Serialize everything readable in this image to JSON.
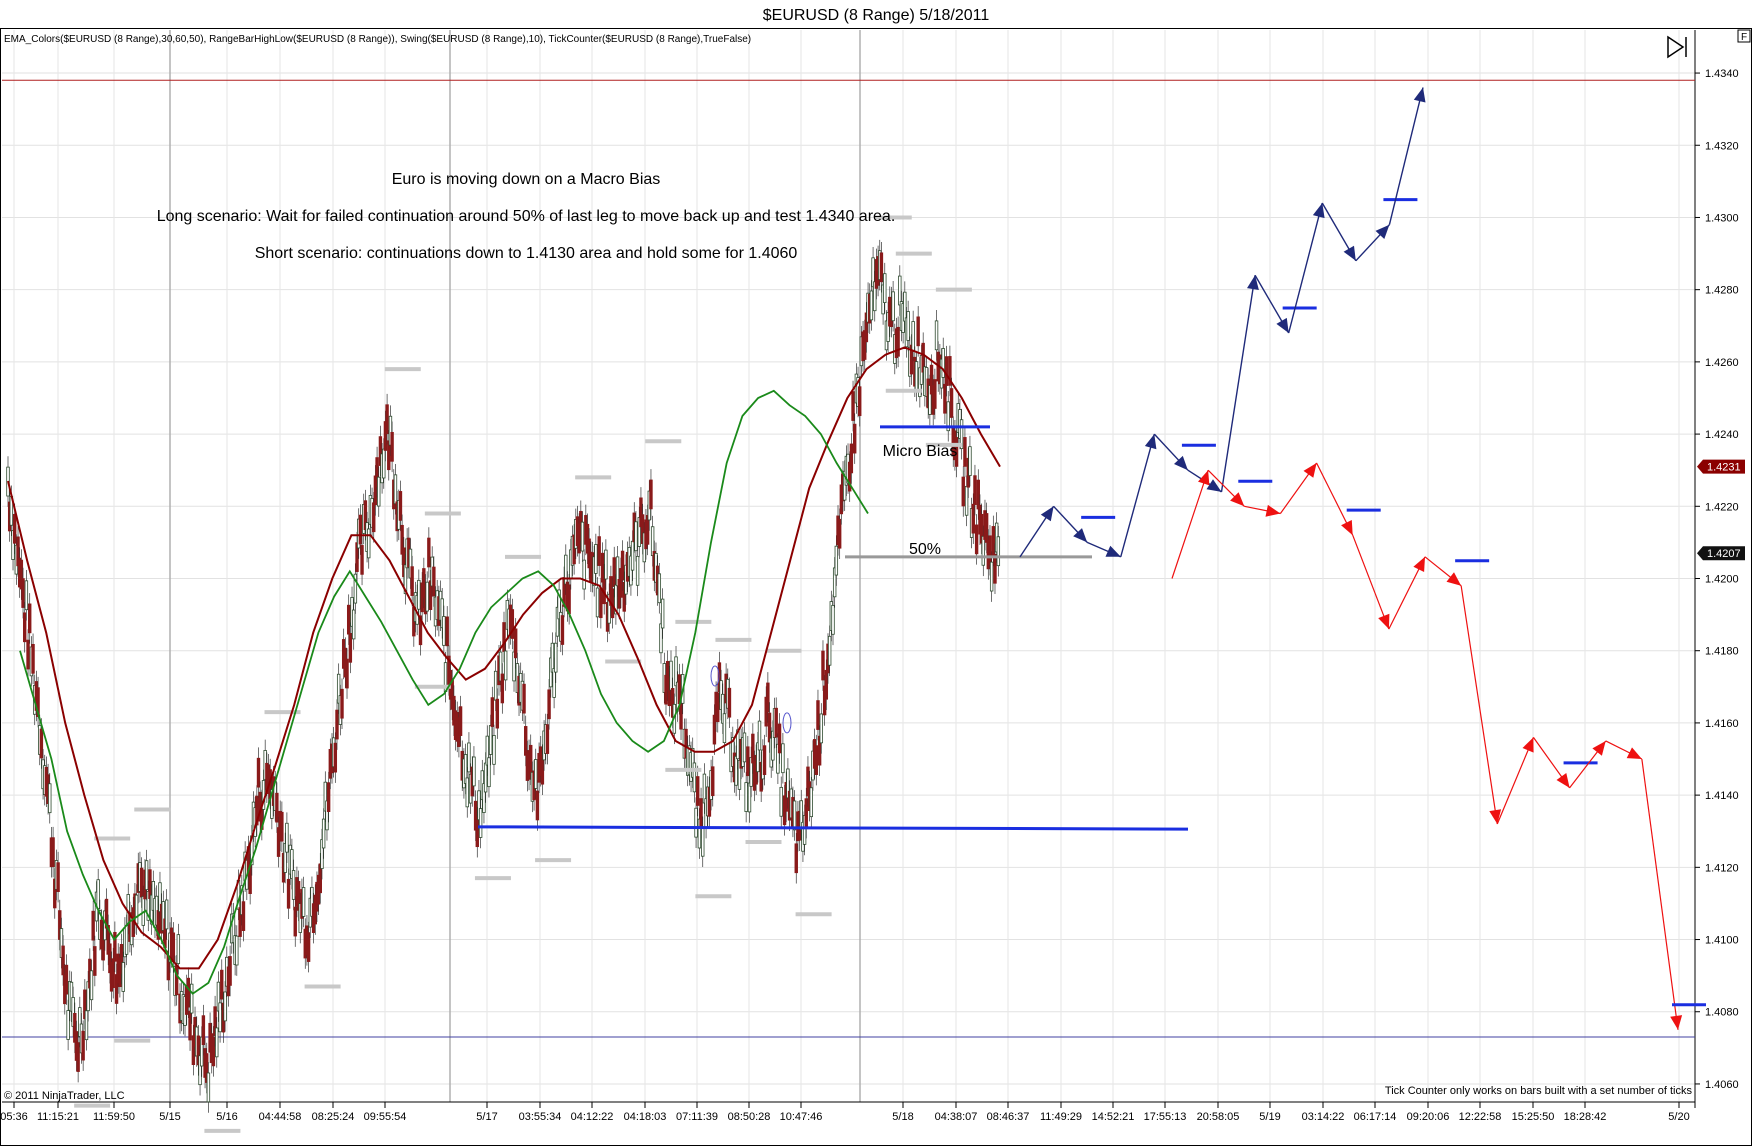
{
  "window": {
    "title": "$EURUSD (8 Range)  5/18/2011",
    "indicators": "EMA_Colors($EURUSD (8 Range),30,60,50), RangeBarHighLow($EURUSD (8 Range)), Swing($EURUSD (8 Range),10), TickCounter($EURUSD (8 Range),TrueFalse)",
    "copyright": "© 2011 NinjaTrader, LLC",
    "tick_note": "Tick Counter only works on bars built with a set number of ticks",
    "corner_label": "F"
  },
  "annotations": {
    "macro": "Euro is moving down on a Macro Bias",
    "long": "Long scenario: Wait for failed continuation around 50% of last leg to move back up and test 1.4340 area.",
    "short": "Short scenario: continuations down to 1.4130 area and hold some for 1.4060",
    "micro_bias": "Micro Bias",
    "fifty": "50%"
  },
  "colors": {
    "up_candle": "#2e4a2e",
    "down_candle": "#8a1a1a",
    "ema_fast_green": "#1a8a1a",
    "ema_slow_red": "#8b0000",
    "bull_path": "#1f2a7a",
    "bear_path": "#ee1111",
    "support_line": "#1a2ee0",
    "resistance_red_line": "#b02020",
    "low_line_navy": "#4040a0",
    "swing_marker": "#c8c8c8",
    "last_price_tag": "#8b0000",
    "current_price_tag": "#111111"
  },
  "chart_data": {
    "type": "candlestick",
    "title": "$EURUSD (8 Range)  5/18/2011",
    "ylim": [
      1.4055,
      1.4345
    ],
    "y_ticks": [
      "1.4340",
      "1.4320",
      "1.4300",
      "1.4280",
      "1.4260",
      "1.4240",
      "1.4220",
      "1.4200",
      "1.4180",
      "1.4160",
      "1.4140",
      "1.4120",
      "1.4100",
      "1.4080",
      "1.4060"
    ],
    "x_ticks": [
      "05:36",
      "11:15:21",
      "11:59:50",
      "5/15",
      "5/16",
      "04:44:58",
      "08:25:24",
      "09:55:54",
      "5/17",
      "03:55:34",
      "04:12:22",
      "04:18:03",
      "07:11:39",
      "08:50:28",
      "10:47:46",
      "5/18",
      "04:38:07",
      "08:46:37",
      "11:49:29",
      "14:52:21",
      "17:55:13",
      "20:58:05",
      "5/19",
      "03:14:22",
      "06:17:14",
      "09:20:06",
      "12:22:58",
      "15:25:50",
      "18:28:42",
      "5/20"
    ],
    "price_tags": [
      {
        "label": "1.4231",
        "value": 1.4231,
        "role": "ema"
      },
      {
        "label": "1.4207",
        "value": 1.4207,
        "role": "last"
      }
    ],
    "horizontal_lines": [
      {
        "name": "resistance",
        "value": 1.4338
      },
      {
        "name": "lower-target",
        "value": 1.4073
      },
      {
        "name": "support-4130",
        "value": 1.4131
      },
      {
        "name": "micro-bias",
        "value": 1.4242
      },
      {
        "name": "fifty-percent",
        "value": 1.4206
      }
    ],
    "price_path": [
      1.4227,
      1.4205,
      1.4185,
      1.4165,
      1.414,
      1.411,
      1.408,
      1.4072,
      1.4085,
      1.411,
      1.41,
      1.409,
      1.4105,
      1.4118,
      1.411,
      1.4105,
      1.41,
      1.409,
      1.408,
      1.4072,
      1.4065,
      1.4078,
      1.4092,
      1.4105,
      1.412,
      1.414,
      1.4145,
      1.4135,
      1.4118,
      1.411,
      1.4105,
      1.412,
      1.414,
      1.4165,
      1.4185,
      1.4205,
      1.4215,
      1.4232,
      1.424,
      1.4222,
      1.42,
      1.4188,
      1.42,
      1.419,
      1.4175,
      1.416,
      1.4145,
      1.4135,
      1.4148,
      1.417,
      1.4188,
      1.4175,
      1.415,
      1.414,
      1.4165,
      1.419,
      1.42,
      1.421,
      1.4205,
      1.42,
      1.4195,
      1.42,
      1.4205,
      1.421,
      1.422,
      1.4195,
      1.4165,
      1.417,
      1.415,
      1.413,
      1.4145,
      1.4165,
      1.416,
      1.4148,
      1.4145,
      1.415,
      1.4162,
      1.4148,
      1.4135,
      1.4125,
      1.414,
      1.416,
      1.4185,
      1.421,
      1.4235,
      1.4255,
      1.4275,
      1.4282,
      1.427,
      1.4272,
      1.4265,
      1.4262,
      1.4255,
      1.4262,
      1.425,
      1.4235,
      1.4225,
      1.4215,
      1.4208,
      1.4205
    ],
    "ema_fast": [
      1.418,
      1.4165,
      1.415,
      1.413,
      1.4118,
      1.4108,
      1.41,
      1.4105,
      1.4108,
      1.41,
      1.409,
      1.4085,
      1.4088,
      1.4098,
      1.4112,
      1.4125,
      1.414,
      1.4155,
      1.417,
      1.4185,
      1.4195,
      1.4202,
      1.4195,
      1.4188,
      1.418,
      1.4172,
      1.4165,
      1.4168,
      1.4175,
      1.4185,
      1.4192,
      1.4196,
      1.42,
      1.4202,
      1.4198,
      1.419,
      1.418,
      1.4168,
      1.416,
      1.4155,
      1.4152,
      1.4155,
      1.4165,
      1.4185,
      1.421,
      1.4232,
      1.4245,
      1.425,
      1.4252,
      1.4248,
      1.4245,
      1.424,
      1.4232,
      1.4225,
      1.4218
    ],
    "ema_slow": [
      1.4227,
      1.4205,
      1.4185,
      1.416,
      1.414,
      1.4122,
      1.411,
      1.4102,
      1.4098,
      1.4092,
      1.4092,
      1.41,
      1.4115,
      1.4132,
      1.4148,
      1.4165,
      1.4185,
      1.42,
      1.4212,
      1.4212,
      1.4205,
      1.4195,
      1.4185,
      1.4178,
      1.4172,
      1.4175,
      1.4182,
      1.419,
      1.4196,
      1.42,
      1.42,
      1.4198,
      1.419,
      1.4178,
      1.4165,
      1.4155,
      1.4152,
      1.4152,
      1.4155,
      1.4165,
      1.4185,
      1.4205,
      1.4225,
      1.4238,
      1.425,
      1.4258,
      1.4262,
      1.4264,
      1.4262,
      1.4258,
      1.425,
      1.424,
      1.4231
    ],
    "bull_scenario": [
      1.4206,
      1.422,
      1.421,
      1.4206,
      1.424,
      1.423,
      1.4224,
      1.4284,
      1.4268,
      1.4304,
      1.4288,
      1.4298,
      1.4336
    ],
    "bear_scenario": [
      1.42,
      1.423,
      1.422,
      1.4218,
      1.4232,
      1.4212,
      1.4186,
      1.4206,
      1.4198,
      1.4132,
      1.4156,
      1.4142,
      1.4155,
      1.415,
      1.4075
    ]
  }
}
